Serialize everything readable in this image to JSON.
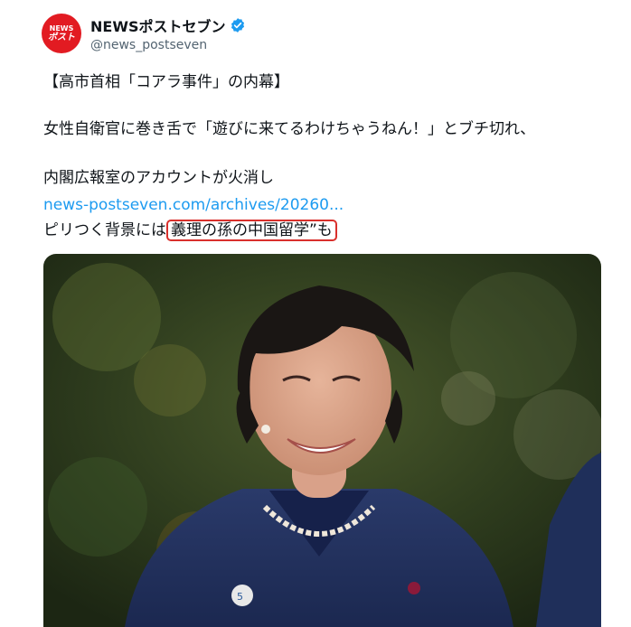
{
  "account": {
    "avatar_top": "NEWS",
    "avatar_bottom": "ポスト",
    "display_name": "NEWSポストセブン",
    "handle": "@news_postseven",
    "verified_icon": "verified-badge-icon"
  },
  "tweet": {
    "line1": "【高市首相「コアラ事件」の内幕】",
    "line2": "女性自衛官に巻き舌で「遊びに来てるわけちゃうねん！」とブチ切れ、",
    "line3": "内閣広報室のアカウントが火消し",
    "link": "news-postseven.com/archives/20260...",
    "line5_prefix": "ピリつく背景には",
    "line5_highlight": "義理の孫の中国留学”も"
  },
  "media": {
    "badge_text": "5",
    "description_icon": "photo-of-woman"
  },
  "colors": {
    "link": "#1d9bf0",
    "highlight_border": "#d9302c",
    "avatar_bg": "#e21b22",
    "verified": "#1d9bf0"
  }
}
